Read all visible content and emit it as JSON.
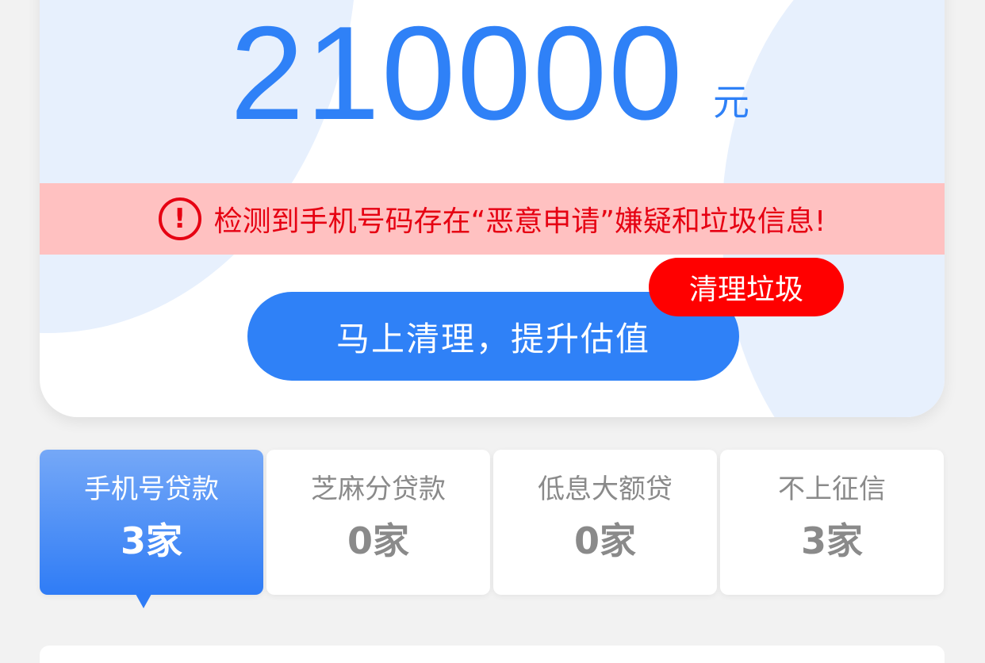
{
  "estimate": {
    "amount": "210000",
    "unit": "元"
  },
  "warning": {
    "icon": "exclamation-circle-icon",
    "text": "检测到手机号码存在“恶意申请”嫌疑和垃圾信息!"
  },
  "cta": {
    "label": "马上清理，提升估值",
    "tag": "清理垃圾"
  },
  "tabs": [
    {
      "label": "手机号贷款",
      "count": "3家",
      "active": true
    },
    {
      "label": "芝麻分贷款",
      "count": "0家",
      "active": false
    },
    {
      "label": "低息大额贷",
      "count": "0家",
      "active": false
    },
    {
      "label": "不上征信",
      "count": "3家",
      "active": false
    }
  ],
  "colors": {
    "primary": "#2f81f7",
    "warning_bg": "#ffc1c1",
    "warning_text": "#e60012",
    "tag": "#ff0000"
  }
}
